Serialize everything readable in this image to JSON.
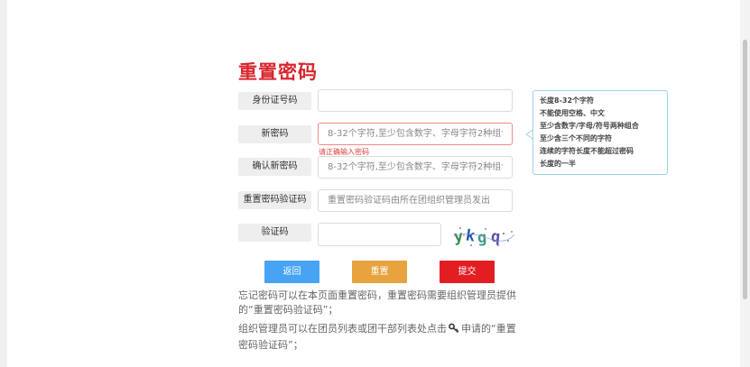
{
  "title": "重置密码",
  "form": {
    "id_number": {
      "label": "身份证号码",
      "value": "",
      "placeholder": ""
    },
    "new_password": {
      "label": "新密码",
      "placeholder": "8-32个字符,至少包含数字、字母字符2种组合",
      "error": "请正确输入密码"
    },
    "confirm_password": {
      "label": "确认新密码",
      "placeholder": "8-32个字符,至少包含数字、字母字符2种组合"
    },
    "reset_code": {
      "label": "重置密码验证码",
      "placeholder": "重置密码验证码由所在团组织管理员发出"
    },
    "captcha": {
      "label": "验证码",
      "value": "",
      "image_text": "ykgq"
    }
  },
  "buttons": {
    "back": "返回",
    "reset": "重置",
    "submit": "提交"
  },
  "notes": {
    "line1": "忘记密码可以在本页面重置密码，重置密码需要组织管理员提供的“重置密码验证码”；",
    "line2_before": "组织管理员可以在团员列表或团干部列表处点击",
    "line2_after": "申请的“重置密码验证码”；",
    "key_icon": "key-icon"
  },
  "hint": {
    "lines": [
      "长度8-32个字符",
      "不能使用空格、中文",
      "至少含数字/字母/符号两种组合",
      "至少含三个不同的字符",
      "连续的字符长度不能超过密码",
      "长度的一半"
    ]
  },
  "colors": {
    "title": "#d8262e",
    "back_button": "#47a3f3",
    "reset_button": "#e7a33e",
    "submit_button": "#e21e23",
    "hint_border": "#9ed2ee",
    "error": "#e23c3c"
  }
}
